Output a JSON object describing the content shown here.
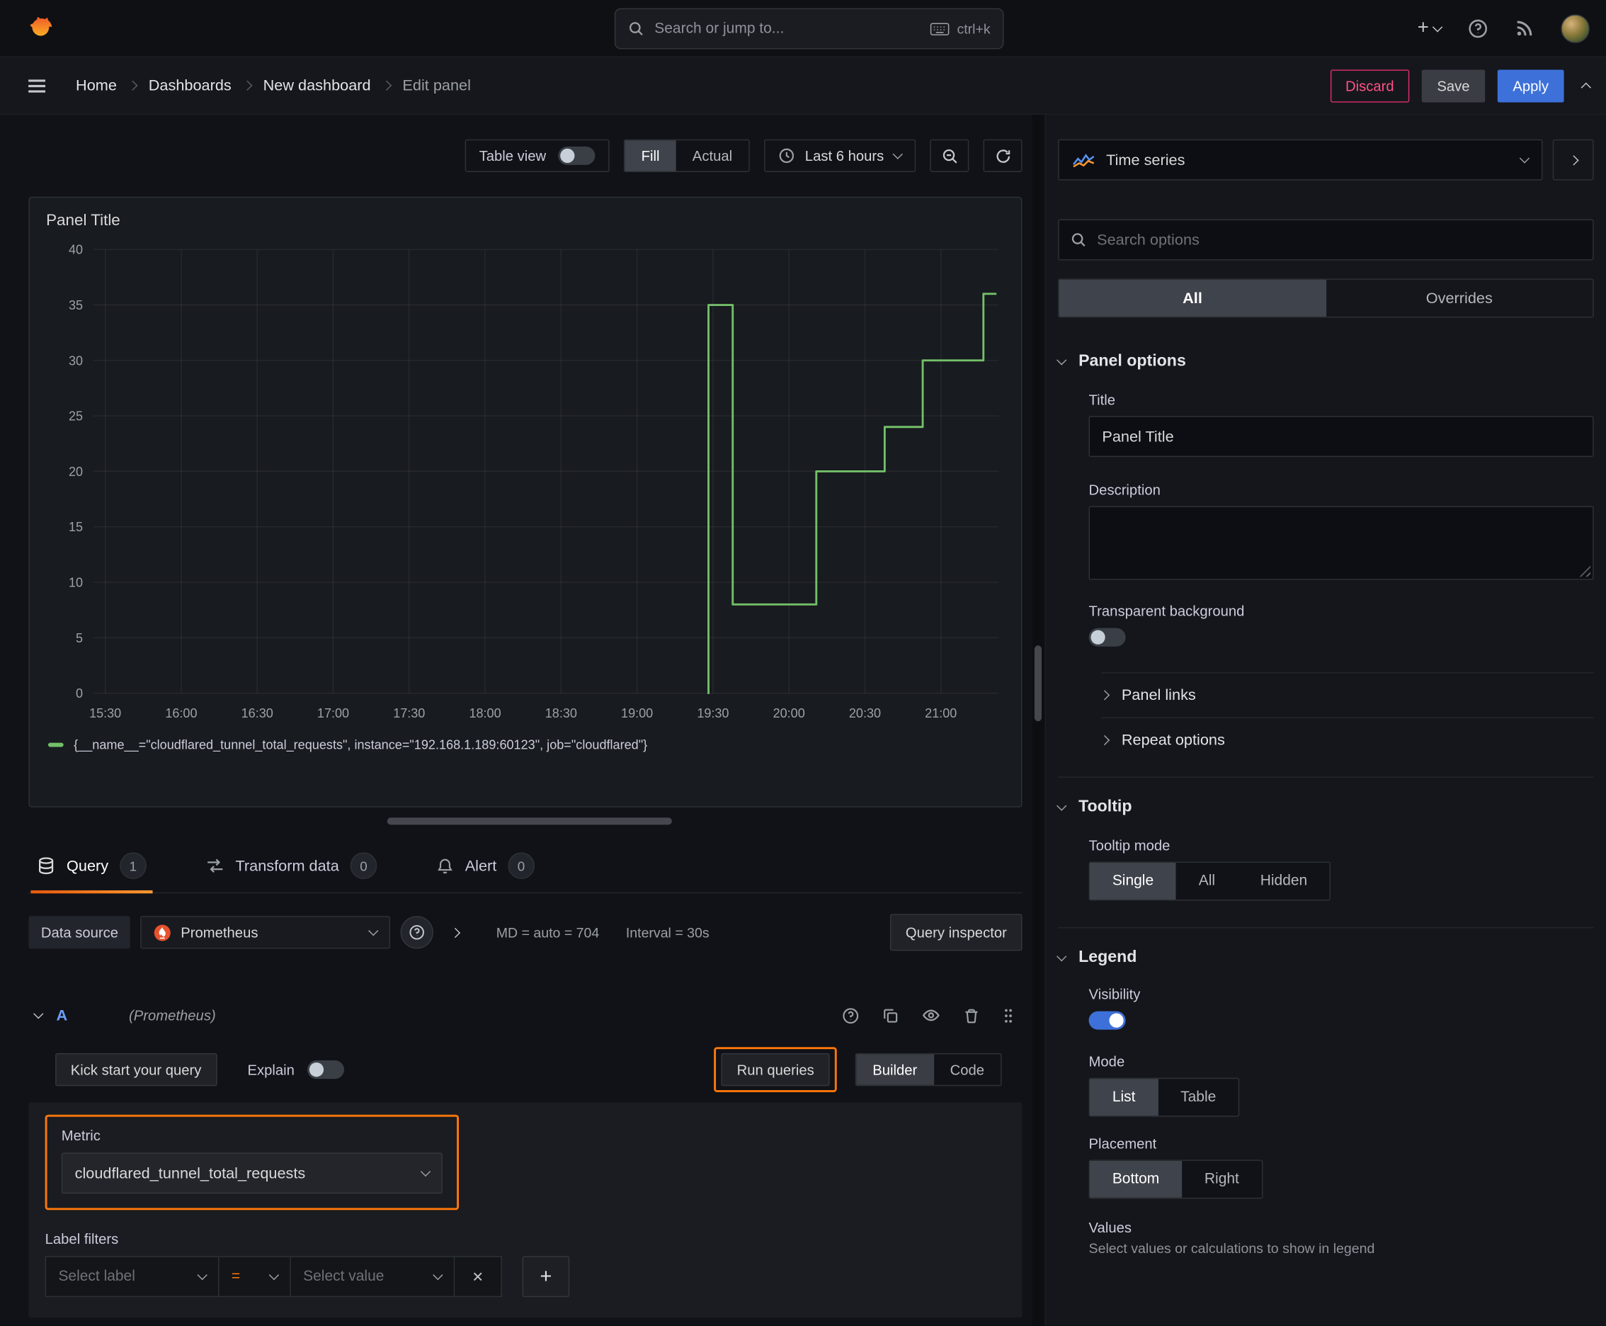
{
  "topbar": {
    "search_placeholder": "Search or jump to...",
    "shortcut": "ctrl+k"
  },
  "breadcrumb": [
    "Home",
    "Dashboards",
    "New dashboard",
    "Edit panel"
  ],
  "actions": {
    "discard": "Discard",
    "save": "Save",
    "apply": "Apply"
  },
  "panel_toolbar": {
    "table_view_label": "Table view",
    "fill_label": "Fill",
    "actual_label": "Actual",
    "time_range_label": "Last 6 hours"
  },
  "panel": {
    "title": "Panel Title"
  },
  "chart_data": {
    "type": "line",
    "title": "Panel Title",
    "x_range": [
      15.42,
      21.38
    ],
    "y_range": [
      0,
      40
    ],
    "y_ticks": [
      0,
      5,
      10,
      15,
      20,
      25,
      30,
      35,
      40
    ],
    "x_ticks": [
      {
        "v": 15.5,
        "label": "15:30"
      },
      {
        "v": 16,
        "label": "16:00"
      },
      {
        "v": 16.5,
        "label": "16:30"
      },
      {
        "v": 17,
        "label": "17:00"
      },
      {
        "v": 17.5,
        "label": "17:30"
      },
      {
        "v": 18,
        "label": "18:00"
      },
      {
        "v": 18.5,
        "label": "18:30"
      },
      {
        "v": 19,
        "label": "19:00"
      },
      {
        "v": 19.5,
        "label": "19:30"
      },
      {
        "v": 20,
        "label": "20:00"
      },
      {
        "v": 20.5,
        "label": "20:30"
      },
      {
        "v": 21,
        "label": "21:00"
      }
    ],
    "grid": true,
    "legend_position": "bottom",
    "series": [
      {
        "name": "{__name__=\"cloudflared_tunnel_total_requests\", instance=\"192.168.1.189:60123\", job=\"cloudflared\"}",
        "color": "#73bf69",
        "render": "step",
        "points": [
          [
            19.47,
            0
          ],
          [
            19.47,
            35
          ],
          [
            19.63,
            35
          ],
          [
            19.63,
            8
          ],
          [
            20.18,
            8
          ],
          [
            20.18,
            20
          ],
          [
            20.63,
            20
          ],
          [
            20.63,
            24
          ],
          [
            20.88,
            24
          ],
          [
            20.88,
            30
          ],
          [
            21.28,
            30
          ],
          [
            21.28,
            36
          ],
          [
            21.36,
            36
          ]
        ]
      }
    ]
  },
  "editor_tabs": {
    "query_label": "Query",
    "query_count": "1",
    "transform_label": "Transform data",
    "transform_count": "0",
    "alert_label": "Alert",
    "alert_count": "0"
  },
  "query_toolbar": {
    "datasource_label": "Data source",
    "datasource_value": "Prometheus",
    "stats_md": "MD = auto = 704",
    "stats_interval": "Interval = 30s",
    "inspector_label": "Query inspector"
  },
  "query_row": {
    "ref_id": "A",
    "datasource_hint": "(Prometheus)"
  },
  "query_actions": {
    "kickstart_label": "Kick start your query",
    "explain_label": "Explain",
    "run_label": "Run queries",
    "builder_label": "Builder",
    "code_label": "Code"
  },
  "metric": {
    "label": "Metric",
    "value": "cloudflared_tunnel_total_requests"
  },
  "label_filters": {
    "label": "Label filters",
    "select_label_placeholder": "Select label",
    "operator": "=",
    "select_value_placeholder": "Select value"
  },
  "options_pane": {
    "viz_name": "Time series",
    "search_placeholder": "Search options",
    "tab_all": "All",
    "tab_overrides": "Overrides",
    "panel_options": {
      "header": "Panel options",
      "title_label": "Title",
      "title_value": "Panel Title",
      "description_label": "Description",
      "transparent_label": "Transparent background",
      "panel_links": "Panel links",
      "repeat_options": "Repeat options"
    },
    "tooltip": {
      "header": "Tooltip",
      "mode_label": "Tooltip mode",
      "modes": [
        "Single",
        "All",
        "Hidden"
      ],
      "selected_mode": "Single"
    },
    "legend": {
      "header": "Legend",
      "visibility_label": "Visibility",
      "mode_label": "Mode",
      "modes": [
        "List",
        "Table"
      ],
      "selected_mode": "List",
      "placement_label": "Placement",
      "placements": [
        "Bottom",
        "Right"
      ],
      "selected_placement": "Bottom",
      "values_label": "Values",
      "values_help": "Select values or calculations to show in legend"
    }
  }
}
